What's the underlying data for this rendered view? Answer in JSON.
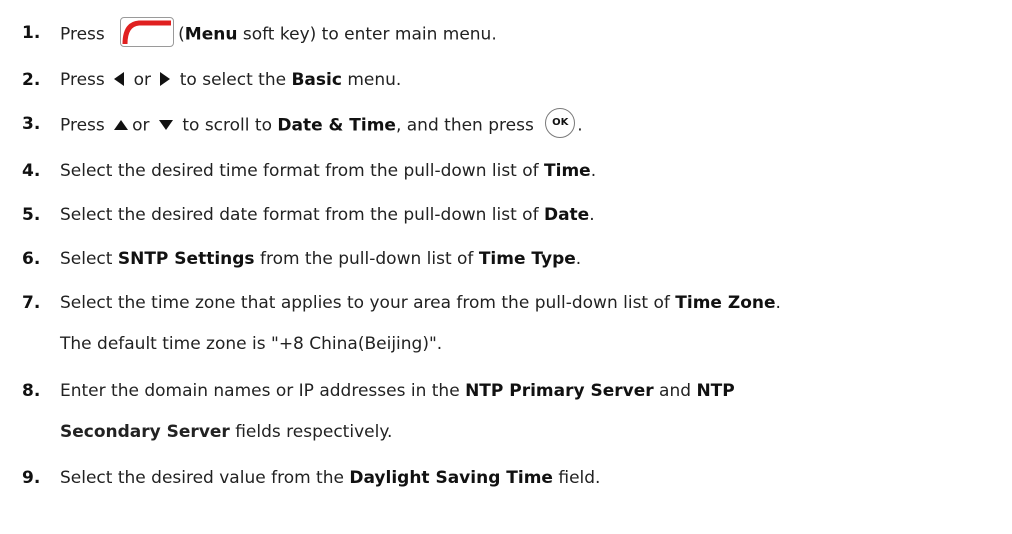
{
  "steps": [
    {
      "num": "1.",
      "pre": "Press",
      "key_label": "(",
      "b1": "Menu",
      "post": " soft key) to enter main menu."
    },
    {
      "num": "2.",
      "pre": "Press",
      "mid": "or",
      "post": "to select the",
      "b1": "Basic",
      "tail": " menu."
    },
    {
      "num": "3.",
      "pre": "Press",
      "mid": "or",
      "post": "to scroll to",
      "b1": "Date & Time",
      "tail": ", and then press",
      "end": "."
    },
    {
      "num": "4.",
      "pre": "Select the desired time format from the pull-down list of ",
      "b1": "Time",
      "tail": "."
    },
    {
      "num": "5.",
      "pre": "Select the desired date format from the pull-down list of ",
      "b1": "Date",
      "tail": "."
    },
    {
      "num": "6.",
      "pre": "Select ",
      "b1": "SNTP Settings",
      "mid": " from the pull-down list of ",
      "b2": "Time Type",
      "tail": "."
    },
    {
      "num": "7.",
      "pre": "Select the time zone that applies to your area from the pull-down list of ",
      "b1": "Time Zone",
      "tail": "."
    },
    {
      "num": "8.",
      "pre": "Enter the domain names or IP addresses in the ",
      "b1": "NTP Primary Server",
      "mid": " and ",
      "b2": "NTP"
    },
    {
      "num": "9.",
      "pre": "Select the desired value from the ",
      "b1": "Daylight Saving Time",
      "tail": " field."
    }
  ],
  "step7_note": "The default time zone is \"+8 China(Beijing)\".",
  "step8_cont": {
    "b1": "Secondary Server",
    "tail": " fields respectively."
  },
  "ok_key_label": "OK",
  "colors": {
    "menu_key_accent": "#e02020",
    "text": "#222222"
  },
  "icons": {
    "menu_key": "menu-soft-key-icon",
    "left": "left-arrow-icon",
    "right": "right-arrow-icon",
    "up": "up-arrow-icon",
    "down": "down-arrow-icon",
    "ok": "ok-key-icon"
  }
}
